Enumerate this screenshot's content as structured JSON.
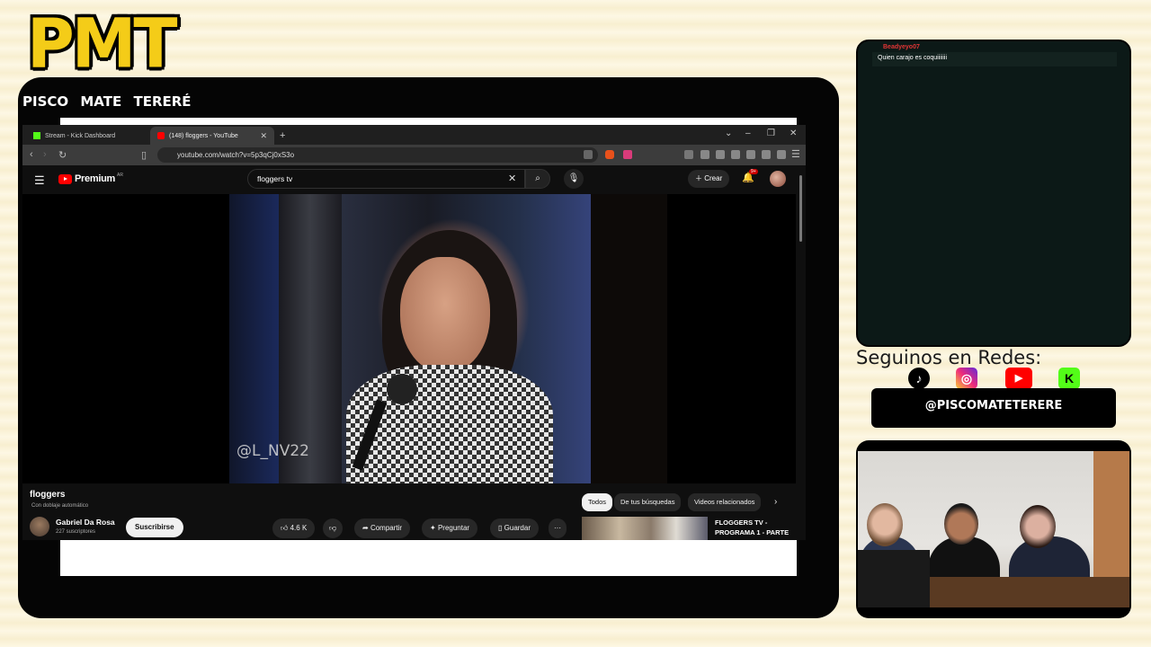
{
  "overlay": {
    "logo": "PMT",
    "tagline": [
      "PISCO",
      "MATE",
      "TERERÉ"
    ],
    "seguinos": "Seguinos en Redes:",
    "handle": "@PISCOMATETERERE",
    "social_icons": [
      "tiktok-icon",
      "instagram-icon",
      "youtube-icon",
      "kick-icon"
    ],
    "colors": {
      "logo_yellow": "#f4cc18",
      "frame": "#050505",
      "background": "#fbf4dc"
    }
  },
  "chat": {
    "username": "Beadyeyo07",
    "message": "Quien carajo es coquiiiiiii"
  },
  "browser": {
    "tabs": [
      {
        "label": "Stream - Kick Dashboard",
        "active": false
      },
      {
        "label": "(148) floggers - YouTube",
        "active": true
      }
    ],
    "new_tab": "+",
    "url": "youtube.com/watch?v=5p3qCj0xS3o"
  },
  "youtube": {
    "brand": "Premium",
    "country": "AR",
    "search_value": "floggers tv",
    "create_label": "Crear",
    "notif_count": "9+",
    "video_watermark": "@L_NV22",
    "video_title": "floggers",
    "dubbing": "Con doblaje automático",
    "channel_name": "Gabriel Da Rosa",
    "channel_subs": "227 suscriptores",
    "subscribe_label": "Suscribirse",
    "likes": "4.6 K",
    "share_label": "Compartir",
    "ask_label": "Preguntar",
    "save_label": "Guardar",
    "more_label": "···",
    "chips": [
      "Todos",
      "De tus búsquedas",
      "Videos relacionados"
    ],
    "rec_title": "FLOGGERS TV - PROGRAMA 1 - PARTE"
  }
}
